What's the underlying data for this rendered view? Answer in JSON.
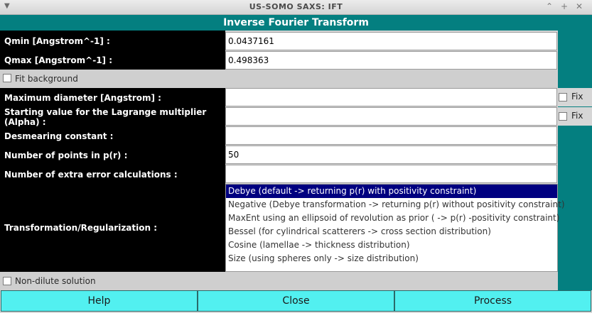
{
  "window": {
    "title": "US-SOMO SAXS: IFT"
  },
  "header": {
    "title": "Inverse Fourier Transform"
  },
  "fields": {
    "qmin": {
      "label": "Qmin [Angstrom^-1] :",
      "value": "0.0437161"
    },
    "qmax": {
      "label": "Qmax [Angstrom^-1] :",
      "value": "0.498363"
    },
    "max_diameter": {
      "label": "Maximum diameter [Angstrom] :",
      "value": "",
      "fix_label": "Fix"
    },
    "alpha": {
      "label": "Starting value for the Lagrange multiplier (Alpha) :",
      "value": "",
      "fix_label": "Fix"
    },
    "desmearing": {
      "label": "Desmearing constant :",
      "value": ""
    },
    "npoints": {
      "label": "Number of points in p(r) :",
      "value": "50"
    },
    "extra_errors": {
      "label": "Number of extra error calculations :",
      "value": ""
    }
  },
  "fit_background": {
    "label": "Fit background",
    "checked": false
  },
  "transformation": {
    "label": "Transformation/Regularization :",
    "options": [
      "Debye (default -> returning p(r) with positivity constraint)",
      "Negative (Debye transformation -> returning p(r) without positivity constraint)",
      "MaxEnt using an ellipsoid of revolution as prior ( -> p(r) -positivity constraint)",
      "Bessel (for cylindrical scatterers -> cross section distribution)",
      "Cosine (lamellae -> thickness distribution)",
      "Size (using spheres only -> size distribution)"
    ],
    "selected": "Debye (default -> returning p(r) with positivity constraint)"
  },
  "non_dilute": {
    "label": "Non-dilute solution",
    "checked": false
  },
  "buttons": {
    "help": "Help",
    "close": "Close",
    "process": "Process"
  }
}
